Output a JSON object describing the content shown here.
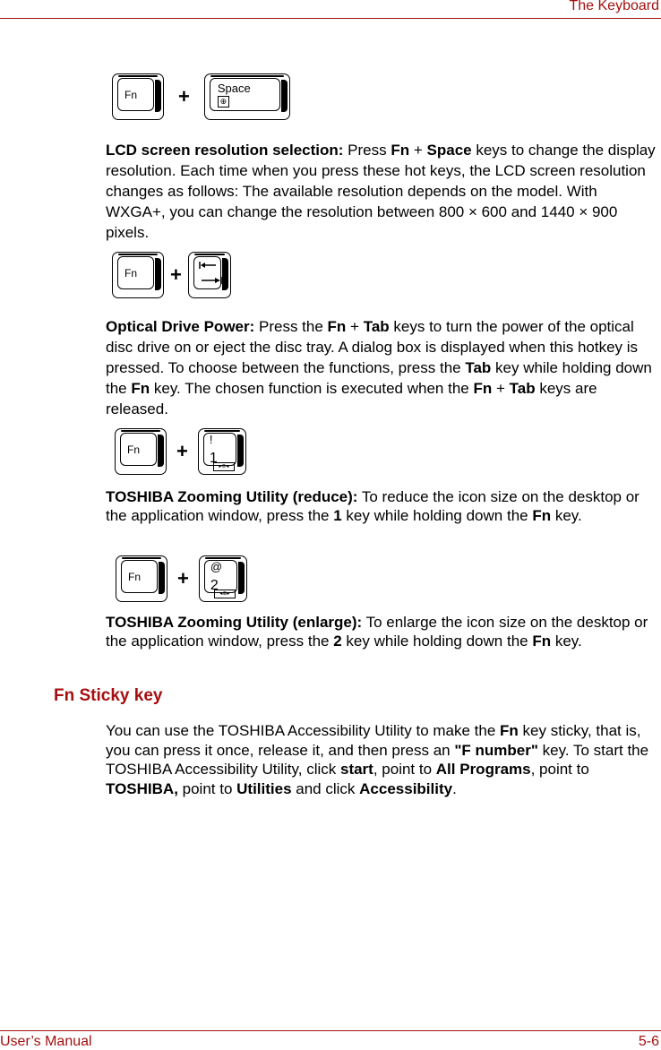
{
  "header": {
    "title": "The Keyboard"
  },
  "footer": {
    "left": "User’s Manual",
    "right": "5-6"
  },
  "plus_sign": "+",
  "keys": {
    "fn": "Fn",
    "space": "Space",
    "space_icon": "⊕",
    "one_top": "!",
    "one_bottom": "1",
    "two_top": "@",
    "two_bottom": "2",
    "zoom_reduce_icon": "▸⊖◂",
    "zoom_enlarge_icon": "◂⊕▸"
  },
  "items": [
    {
      "title": "LCD screen resolution selection:",
      "parts": [
        " Press ",
        "Fn",
        " + ",
        "Space",
        " keys to change the display resolution. Each time when you press these hot keys, the LCD screen resolution changes as follows: The available resolution depends on the model. With WXGA+, you can change the resolution between 800 × 600 and 1440 × 900 pixels."
      ]
    },
    {
      "title": "Optical Drive Power:",
      "parts": [
        " Press the ",
        "Fn",
        " + ",
        "Tab",
        " keys to turn the power of the optical disc drive on or eject the disc tray. A dialog box is displayed when this hotkey is pressed. To choose between the functions, press the ",
        "Tab",
        " key while holding down the ",
        "Fn",
        " key. The chosen function is executed when the ",
        "Fn",
        " + ",
        "Tab",
        " keys are released."
      ]
    },
    {
      "title": "TOSHIBA Zooming Utility (reduce):",
      "parts": [
        " To reduce the icon size on the desktop or the application window, press the ",
        "1",
        " key while holding down the ",
        "Fn",
        " key."
      ]
    },
    {
      "title": "TOSHIBA Zooming Utility (enlarge):",
      "parts": [
        " To enlarge the icon size on the desktop or the application window, press the ",
        "2",
        " key while holding down the ",
        "Fn",
        " key."
      ]
    }
  ],
  "section": {
    "heading": "Fn Sticky key",
    "parts": [
      "You can use the TOSHIBA Accessibility Utility to make the ",
      "Fn",
      " key sticky, that is, you can press it once, release it, and then press an ",
      "\"F number\"",
      " key. To start the TOSHIBA Accessibility Utility, click ",
      "start",
      ", point to ",
      "All Programs",
      ", point to ",
      "TOSHIBA,",
      " point to ",
      "Utilities",
      " and click ",
      "Accessibility",
      "."
    ]
  }
}
